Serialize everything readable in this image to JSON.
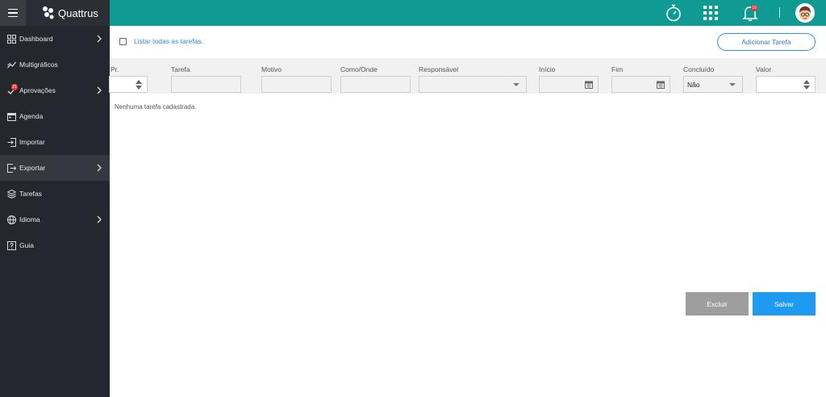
{
  "app": {
    "name": "Quattrus"
  },
  "sidebar": {
    "items": [
      {
        "label": "Dashboard",
        "icon": "dashboard-icon",
        "has_submenu": true
      },
      {
        "label": "Multigráficos",
        "icon": "chart-line-icon",
        "has_submenu": false
      },
      {
        "label": "Aprovações",
        "icon": "approvals-icon",
        "has_submenu": true,
        "badge": "21"
      },
      {
        "label": "Agenda",
        "icon": "calendar-icon",
        "has_submenu": false
      },
      {
        "label": "Importar",
        "icon": "import-icon",
        "has_submenu": false
      },
      {
        "label": "Exportar",
        "icon": "export-icon",
        "has_submenu": true,
        "active": true
      },
      {
        "label": "Tarefas",
        "icon": "layers-icon",
        "has_submenu": false
      },
      {
        "label": "Idioma",
        "icon": "globe-icon",
        "has_submenu": true
      },
      {
        "label": "Guia",
        "icon": "help-icon",
        "has_submenu": false
      }
    ]
  },
  "topbar": {
    "icons": [
      "stopwatch-icon",
      "apps-grid-icon",
      "bell-icon",
      "avatar"
    ],
    "notifications_badge": "10"
  },
  "main": {
    "list_all_label": "Listar todas as tarefas.",
    "list_all_checked": false,
    "add_task_label": "Adicionar Tarefa",
    "columns": [
      "Pr.",
      "Tarefa",
      "Motivo",
      "Como/Onde",
      "Responsável",
      "Início",
      "Fim",
      "Concluído",
      "Valor"
    ],
    "filters": {
      "priority": "",
      "task": "",
      "reason": "",
      "how_where": "",
      "responsible": "",
      "start": "",
      "end": "",
      "completed": "Não",
      "value": ""
    },
    "empty_message": "Nenhuma tarefa cadastrada.",
    "delete_label": "Excluir",
    "save_label": "Salvar"
  },
  "colors": {
    "sidebar_bg": "#24272e",
    "topbar_bg": "#0f9a94",
    "accent_blue": "#1e9bf0",
    "badge_red": "#e53935",
    "delete_gray": "#9e9e9e"
  }
}
